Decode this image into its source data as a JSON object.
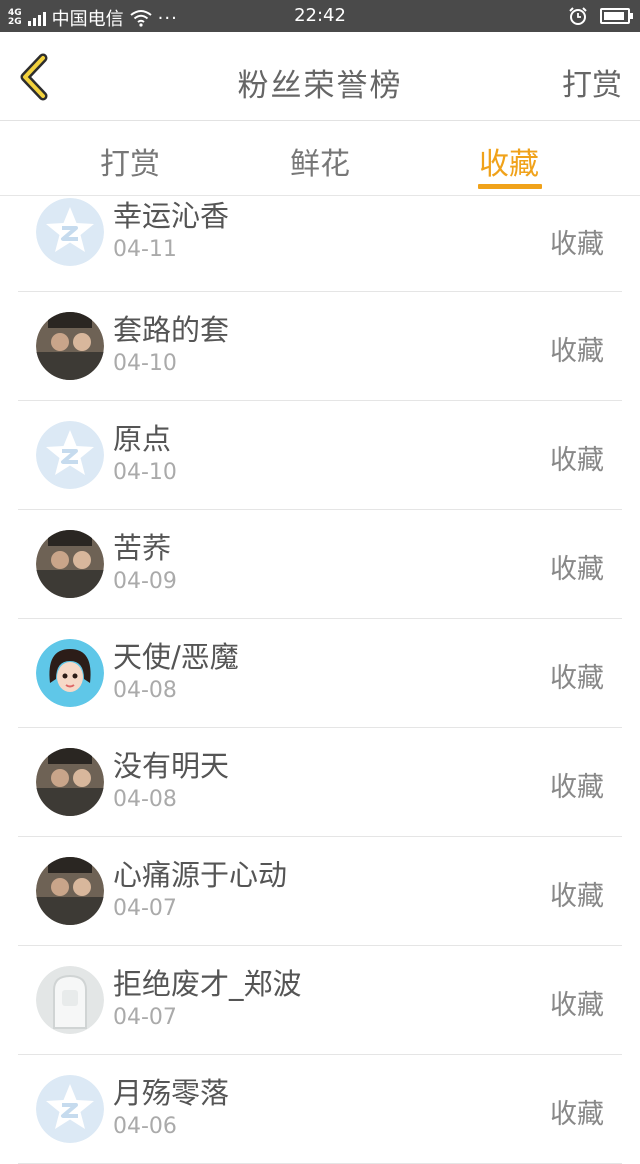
{
  "status_bar": {
    "network": "4G\n2G",
    "carrier": "中国电信",
    "more": "···",
    "time": "22:42",
    "battery_level": 0.9
  },
  "header": {
    "title": "粉丝荣誉榜",
    "action_label": "打赏"
  },
  "tabs": [
    {
      "label": "打赏"
    },
    {
      "label": "鲜花"
    },
    {
      "label": "收藏",
      "active": true
    }
  ],
  "accent_color": "#f0a21a",
  "list": [
    {
      "name": "幸运沁香",
      "date": "04-11",
      "action": "收藏",
      "avatar": "default-avatar"
    },
    {
      "name": "套路的套",
      "date": "04-10",
      "action": "收藏",
      "avatar": "photo-avatar"
    },
    {
      "name": "原点",
      "date": "04-10",
      "action": "收藏",
      "avatar": "default-avatar"
    },
    {
      "name": "苦荞",
      "date": "04-09",
      "action": "收藏",
      "avatar": "photo-avatar"
    },
    {
      "name": "天使/恶魔",
      "date": "04-08",
      "action": "收藏",
      "avatar": "cartoon-avatar"
    },
    {
      "name": "没有明天",
      "date": "04-08",
      "action": "收藏",
      "avatar": "photo-avatar"
    },
    {
      "name": "心痛源于心动",
      "date": "04-07",
      "action": "收藏",
      "avatar": "photo-avatar"
    },
    {
      "name": "拒绝废才_郑波",
      "date": "04-07",
      "action": "收藏",
      "avatar": "placeholder-avatar"
    },
    {
      "name": "月殇零落",
      "date": "04-06",
      "action": "收藏",
      "avatar": "default-avatar"
    }
  ]
}
